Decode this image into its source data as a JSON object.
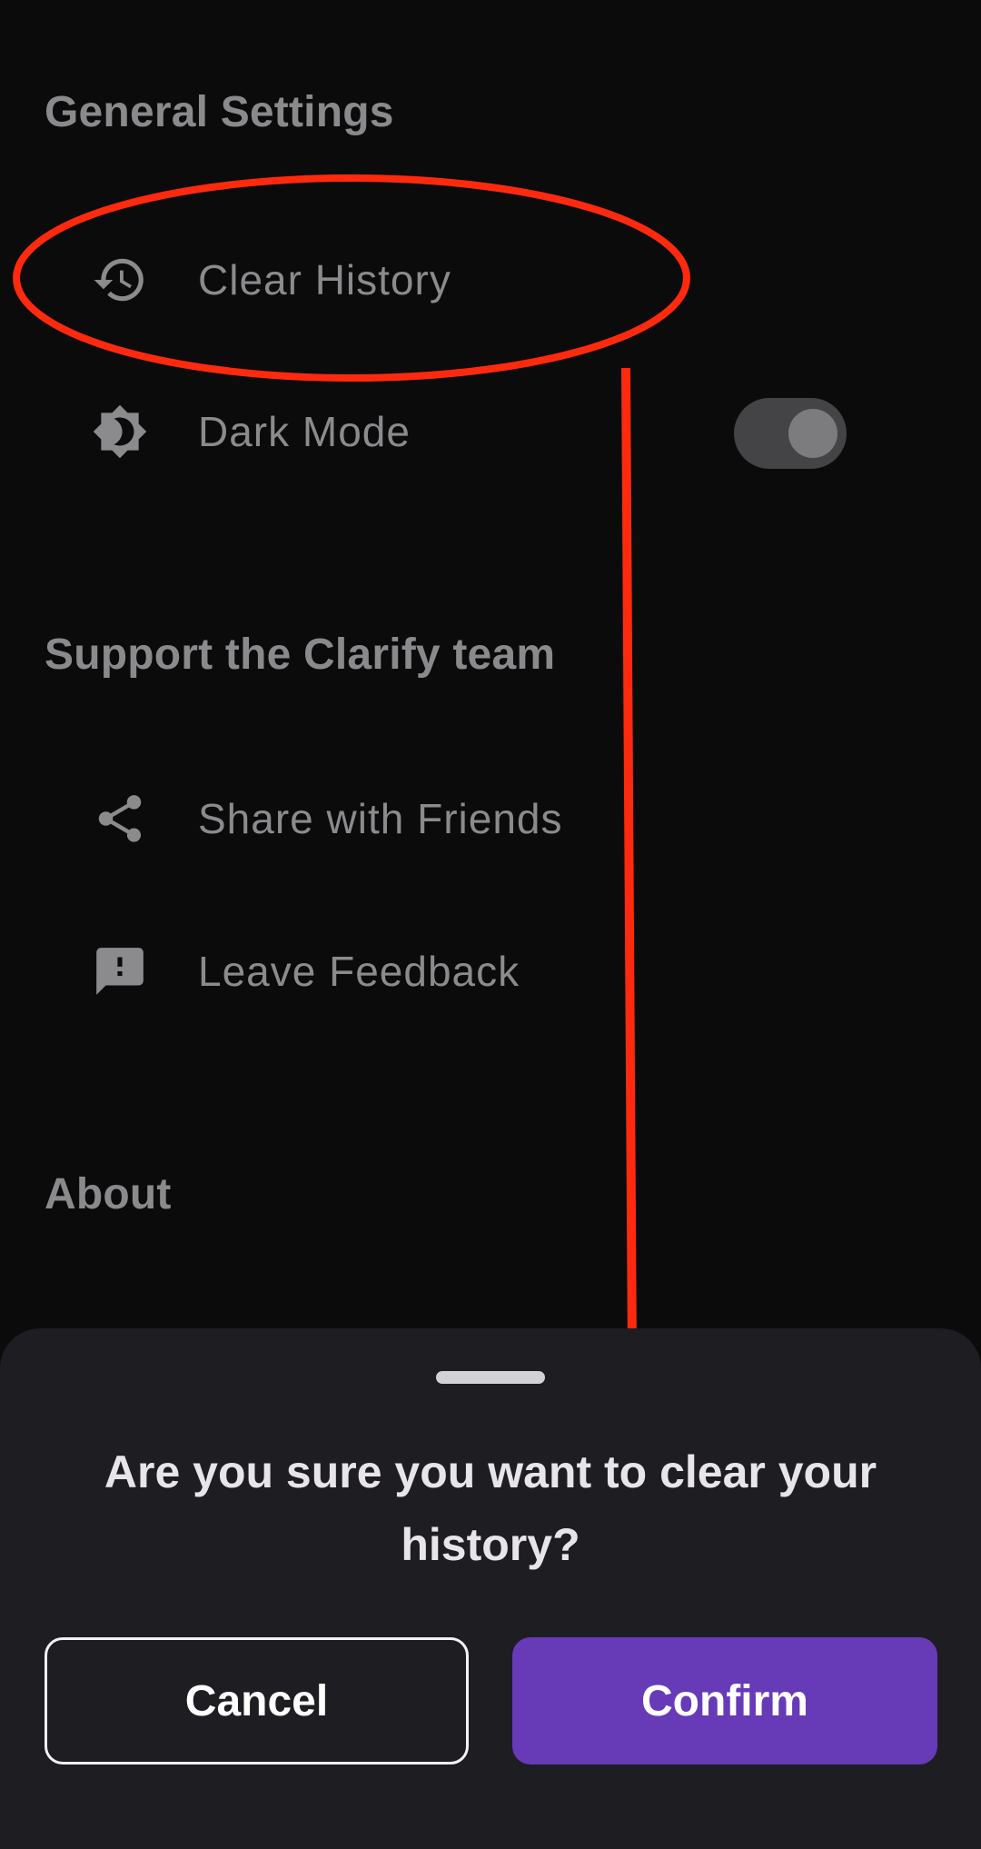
{
  "sections": {
    "general": "General Settings",
    "support": "Support the Clarify team",
    "about": "About"
  },
  "items": {
    "clear_history": {
      "label": "Clear History",
      "icon": "history-icon"
    },
    "dark_mode": {
      "label": "Dark Mode",
      "icon": "brightness-icon",
      "toggle_on": true
    },
    "share": {
      "label": "Share with Friends",
      "icon": "share-icon"
    },
    "feedback": {
      "label": "Leave Feedback",
      "icon": "feedback-icon"
    }
  },
  "dialog": {
    "title": "Are you sure you want to clear your history?",
    "cancel_label": "Cancel",
    "confirm_label": "Confirm"
  },
  "colors": {
    "background": "#0b0b0c",
    "sheet": "#1e1d22",
    "accent": "#673ab7",
    "annotation": "#ff2a0d"
  }
}
